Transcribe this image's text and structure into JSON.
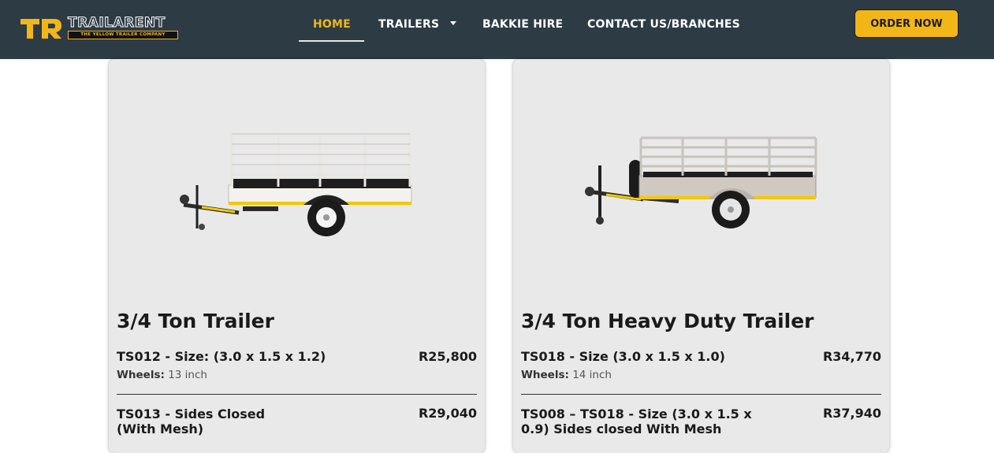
{
  "brand": {
    "name": "TRAILARENT",
    "tagline": "THE YELLOW TRAILER COMPANY",
    "mark": "TR"
  },
  "nav": {
    "items": [
      {
        "label": "HOME",
        "active": true
      },
      {
        "label": "TRAILERS",
        "has_dropdown": true
      },
      {
        "label": "BAKKIE HIRE"
      },
      {
        "label": "CONTACT US/BRANCHES"
      }
    ],
    "cta": "ORDER NOW"
  },
  "colors": {
    "header_bg": "#2d3b45",
    "accent": "#f3b617",
    "card_bg": "#e9e9e9"
  },
  "products": [
    {
      "title": "3/4 Ton Trailer",
      "items": [
        {
          "name": "TS012 - Size: (3.0 x 1.5 x 1.2)",
          "price": "R25,800",
          "spec_label": "Wheels:",
          "spec_value": "13 inch"
        },
        {
          "name": "TS013 - Sides Closed (With Mesh)",
          "price": "R29,040"
        }
      ]
    },
    {
      "title": "3/4 Ton Heavy Duty Trailer",
      "items": [
        {
          "name": "TS018 - Size (3.0 x 1.5 x 1.0)",
          "price": "R34,770",
          "spec_label": "Wheels:",
          "spec_value": "14 inch"
        },
        {
          "name": "TS008 – TS018 - Size (3.0 x 1.5 x 0.9) Sides closed With Mesh",
          "price": "R37,940"
        }
      ]
    }
  ]
}
